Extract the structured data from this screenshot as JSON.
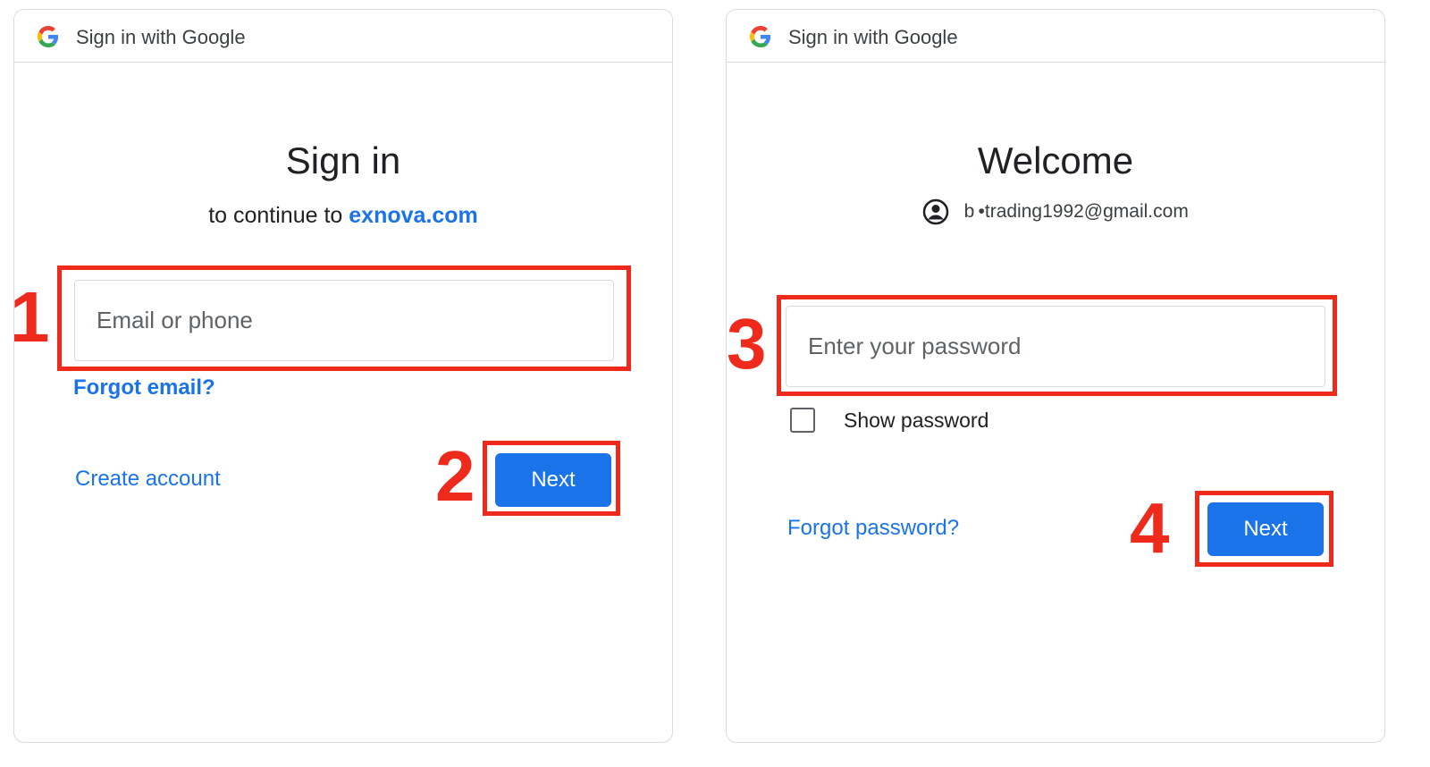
{
  "signin_panel": {
    "header_title": "Sign in with Google",
    "heading": "Sign in",
    "subtitle_prefix": "to continue to",
    "subtitle_host": "exnova.com",
    "email_placeholder": "Email or phone",
    "forgot_email": "Forgot email?",
    "create_account": "Create account",
    "next_label": "Next",
    "step_field": "1",
    "step_next": "2"
  },
  "welcome_panel": {
    "header_title": "Sign in with Google",
    "heading": "Welcome",
    "account_email": "b •trading1992@gmail.com",
    "password_placeholder": "Enter your password",
    "show_password_label": "Show password",
    "show_password_checked": false,
    "forgot_password": "Forgot password?",
    "next_label": "Next",
    "step_field": "3",
    "step_next": "4"
  },
  "colors": {
    "accent_blue": "#1a73e8",
    "annotation_red": "#ee2a1c",
    "border_gray": "#dadce0"
  },
  "icons": {
    "header_logo": "google-g-icon",
    "account": "account-circle-icon"
  }
}
